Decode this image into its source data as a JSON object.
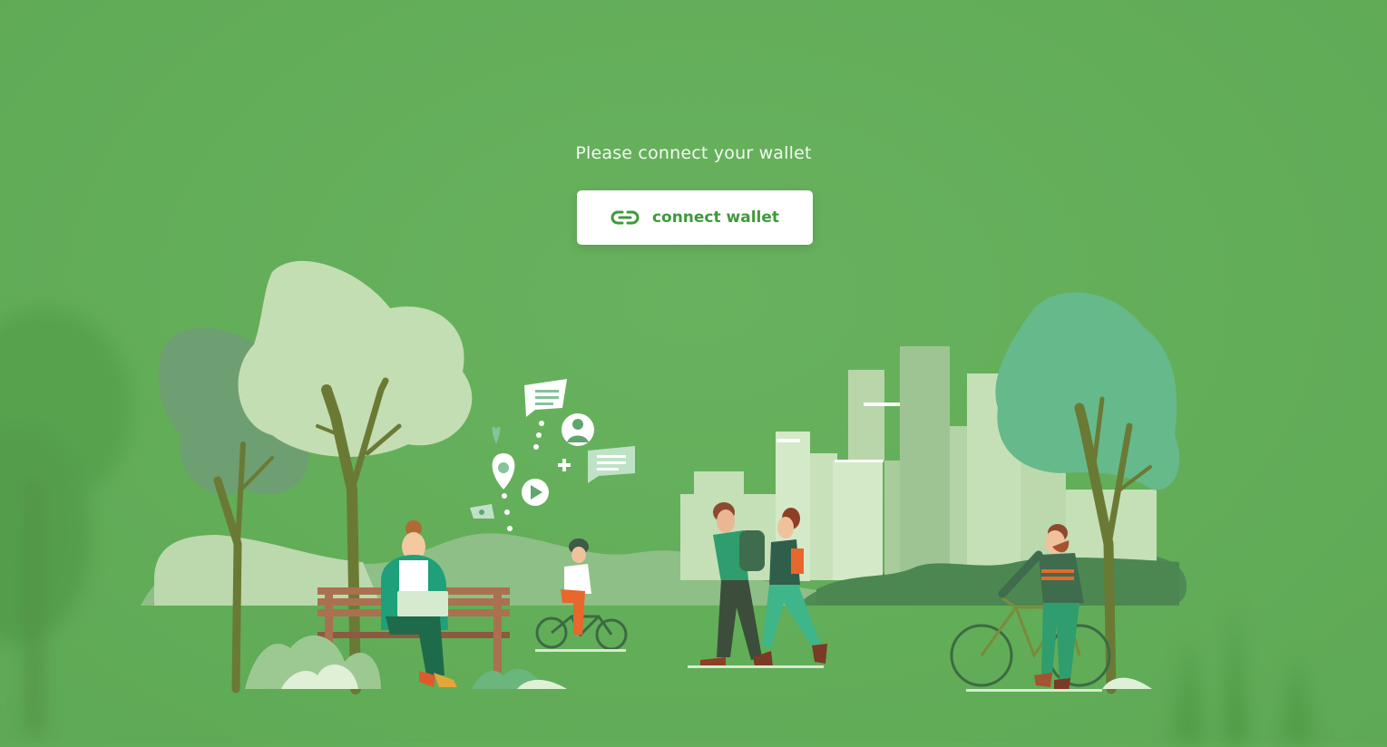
{
  "main": {
    "prompt_text": "Please connect your wallet",
    "connect_button": {
      "label": "connect wallet",
      "icon": "link-icon"
    }
  },
  "illustration": {
    "description_icon": "park-city-illustration"
  },
  "colors": {
    "background": "#62ad58",
    "button_background": "#ffffff",
    "button_text": "#3f9a3c",
    "prompt_text": "#f2faf0"
  }
}
